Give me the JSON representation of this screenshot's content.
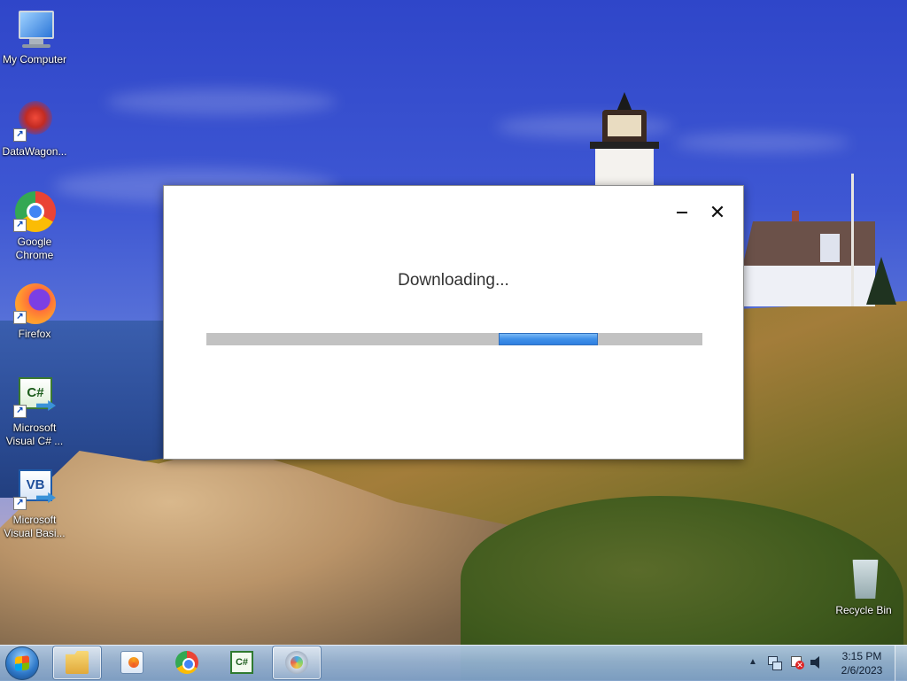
{
  "desktop": {
    "icons": [
      {
        "label": "My Computer",
        "icon": "computer-icon"
      },
      {
        "label": "DataWagon...",
        "icon": "datawagon-icon"
      },
      {
        "label": "Google Chrome",
        "icon": "chrome-icon"
      },
      {
        "label": "Firefox",
        "icon": "firefox-icon"
      },
      {
        "label": "Microsoft Visual C# ...",
        "icon": "visual-csharp-icon",
        "glyph": "C#"
      },
      {
        "label": "Microsoft Visual Basi...",
        "icon": "visual-basic-icon",
        "glyph": "VB"
      },
      {
        "label": "Recycle Bin",
        "icon": "recycle-bin-icon"
      }
    ],
    "shortcut_arrow": "↗"
  },
  "dialog": {
    "status_text": "Downloading...",
    "close_glyph": "✕",
    "progress": {
      "indeterminate": true,
      "segment_start": 0.59,
      "segment_length": 0.2
    }
  },
  "taskbar": {
    "pinned": [
      {
        "name": "windows-explorer",
        "icon": "folder-icon",
        "active": true
      },
      {
        "name": "windows-media-player",
        "icon": "media-player-icon",
        "active": false
      },
      {
        "name": "google-chrome",
        "icon": "chrome-icon",
        "active": false
      },
      {
        "name": "visual-csharp",
        "icon": "visual-csharp-icon",
        "active": false,
        "glyph": "C#"
      },
      {
        "name": "installer",
        "icon": "installer-icon",
        "active": true
      }
    ],
    "tray": {
      "chevron": "▲",
      "clock_time": "3:15 PM",
      "clock_date": "2/6/2023"
    }
  },
  "colors": {
    "progress_fill": "#3e8fe8",
    "progress_track": "#c2c2c2",
    "taskbar": "#96b4d6"
  }
}
